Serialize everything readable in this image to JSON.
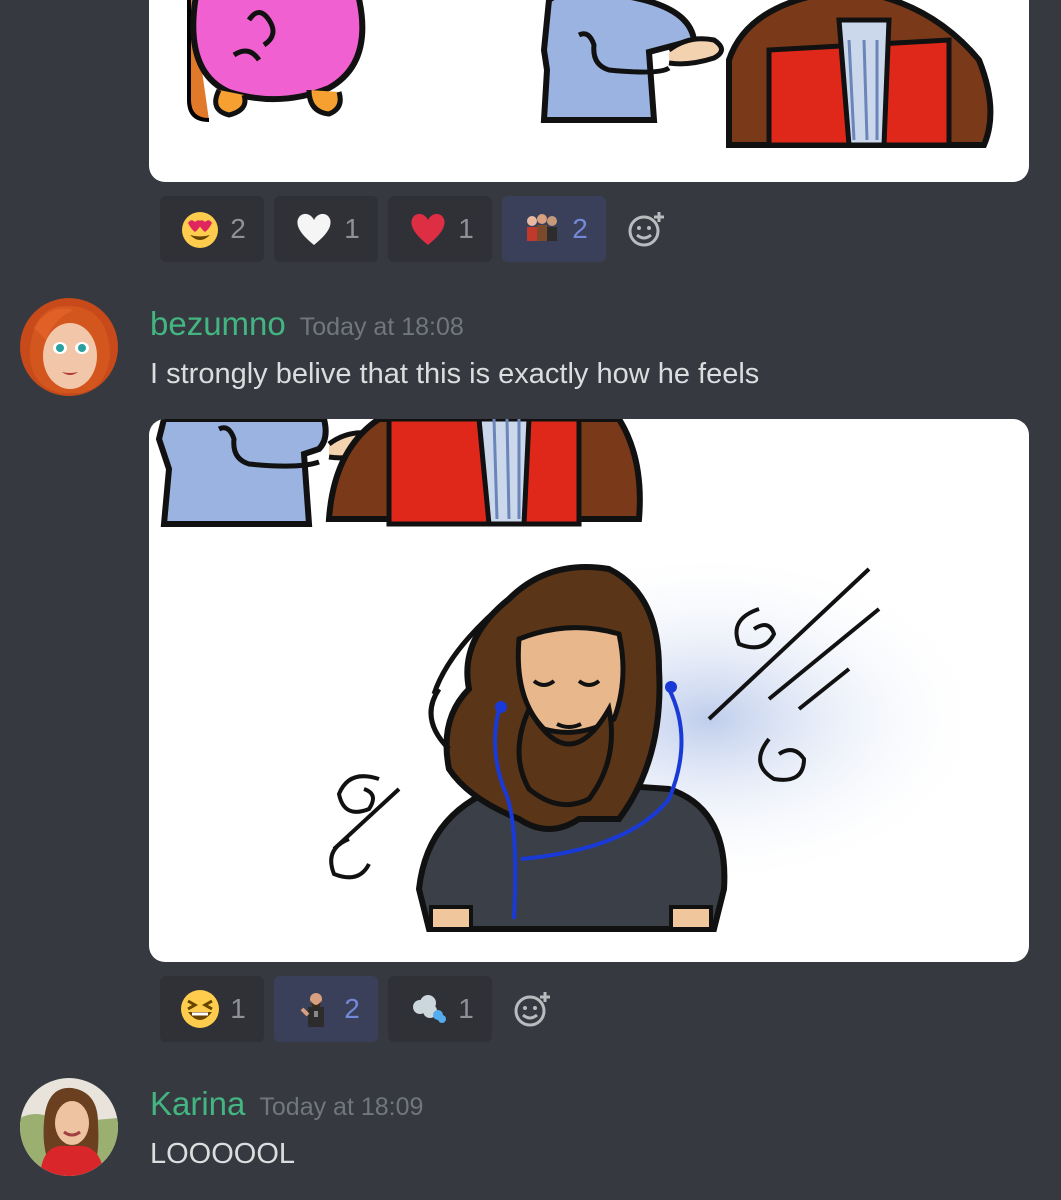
{
  "messages": [
    {
      "id": "prev",
      "reactions": [
        {
          "emoji": "heart-eyes",
          "count": "2",
          "me": false
        },
        {
          "emoji": "white-heart",
          "count": "1",
          "me": false
        },
        {
          "emoji": "red-heart",
          "count": "1",
          "me": false
        },
        {
          "emoji": "custom-group",
          "count": "2",
          "me": true
        }
      ]
    },
    {
      "id": "bezumno",
      "author": "bezumno",
      "timestamp": "Today at 18:08",
      "text": "I strongly belive that this is exactly how he feels",
      "reactions": [
        {
          "emoji": "laughing",
          "count": "1",
          "me": false
        },
        {
          "emoji": "custom-man",
          "count": "2",
          "me": true
        },
        {
          "emoji": "dash",
          "count": "1",
          "me": false
        }
      ]
    },
    {
      "id": "karina",
      "author": "Karina",
      "timestamp": "Today at 18:09",
      "text": "LOOOOOL"
    }
  ],
  "colors": {
    "background": "#36393f",
    "username": "#43b581",
    "text": "#dcddde",
    "timestamp": "#72767d",
    "reaction_bg": "#2f3136",
    "reaction_me_bg": "#3b405a",
    "reaction_me_count": "#7289da"
  }
}
